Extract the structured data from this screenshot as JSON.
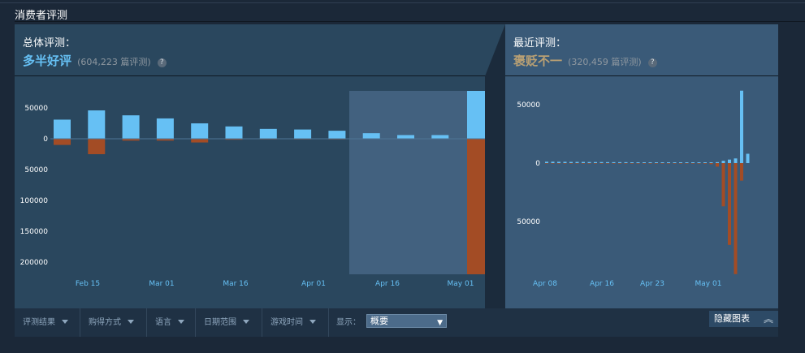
{
  "section": {
    "title": "消费者评测"
  },
  "overall": {
    "label": "总体评测：",
    "summary": "多半好评",
    "summary_color": "#66c0f4",
    "count": "(604,223 篇评测)"
  },
  "recent": {
    "label": "最近评测：",
    "summary": "褒贬不一",
    "summary_color": "#b9a074",
    "count": "(320,459 篇评测)"
  },
  "help_glyph": "?",
  "colors": {
    "positive": "#66c0f4",
    "negative": "#a34c25",
    "axis_label": "#66c0f4"
  },
  "chart_data": [
    {
      "type": "bar",
      "y_ticks": [
        "50000",
        "0",
        "50000",
        "100000",
        "150000",
        "200000"
      ],
      "x_ticks": [
        "Feb 15",
        "Mar 01",
        "Mar 16",
        "Apr 01",
        "Apr 16",
        "May 01"
      ],
      "series": [
        {
          "values": [
            31000,
            46000,
            38000,
            33000,
            25000,
            20000,
            16000,
            15000,
            13000,
            9000,
            6000,
            6000,
            78000
          ]
        },
        {
          "values": [
            -10000,
            -25000,
            -3000,
            -3000,
            -6000,
            -1500,
            -1000,
            -1000,
            -1000,
            0,
            0,
            0,
            -220000
          ]
        }
      ]
    },
    {
      "type": "bar",
      "y_ticks": [
        "50000",
        "0",
        "50000"
      ],
      "x_ticks": [
        "Apr 08",
        "Apr 16",
        "Apr 23",
        "May 01"
      ],
      "series": [
        {
          "values": [
            1200,
            1200,
            1100,
            1100,
            1000,
            1000,
            1000,
            900,
            900,
            900,
            800,
            800,
            800,
            800,
            700,
            700,
            700,
            600,
            600,
            600,
            500,
            500,
            500,
            500,
            500,
            500,
            600,
            600,
            800,
            2000,
            3000,
            4000,
            62000,
            8000
          ]
        },
        {
          "values": [
            -200,
            -200,
            -200,
            -200,
            -200,
            -200,
            -200,
            -200,
            -200,
            -200,
            -200,
            -200,
            -200,
            -200,
            -200,
            -200,
            -200,
            -200,
            -200,
            -200,
            -200,
            -200,
            -300,
            -300,
            -300,
            -300,
            -500,
            -1000,
            -3000,
            -37000,
            -70000,
            -95000,
            -15000,
            0
          ]
        }
      ]
    }
  ],
  "filters": [
    {
      "label": "评测结果"
    },
    {
      "label": "购得方式"
    },
    {
      "label": "语言"
    },
    {
      "label": "日期范围"
    },
    {
      "label": "游戏时间"
    }
  ],
  "display": {
    "label": "显示：",
    "selected": "概要"
  },
  "hide_chart": {
    "label": "隐藏图表",
    "icon": "double-chevron-up-icon"
  }
}
